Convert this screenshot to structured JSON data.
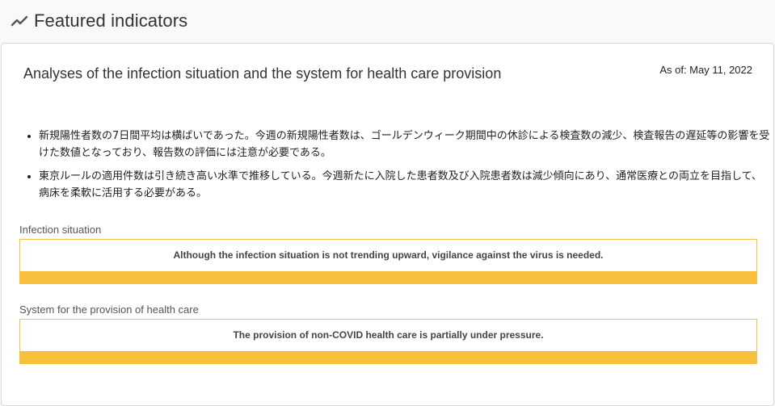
{
  "header": {
    "title": "Featured indicators",
    "icon": "trend-line-icon"
  },
  "card": {
    "title": "Analyses of the infection situation and the system for health care provision",
    "as_of": "As of: May 11, 2022",
    "bullets": [
      "新規陽性者数の7日間平均は横ばいであった。今週の新規陽性者数は、ゴールデンウィーク期間中の休診による検査数の減少、検査報告の遅延等の影響を受けた数値となっており、報告数の評価には注意が必要である。",
      "東京ルールの適用件数は引き続き高い水準で推移している。今週新たに入院した患者数及び入院患者数は減少傾向にあり、通常医療との両立を目指して、病床を柔軟に活用する必要がある。"
    ],
    "sections": [
      {
        "label": "Infection situation",
        "status": "Although the infection situation is not trending upward, vigilance against the virus is needed."
      },
      {
        "label": "System for the provision of health care",
        "status": "The provision of non-COVID health care is partially under pressure."
      }
    ]
  },
  "colors": {
    "status_border": "#f5bf42",
    "status_bar": "#f7bf3c"
  }
}
